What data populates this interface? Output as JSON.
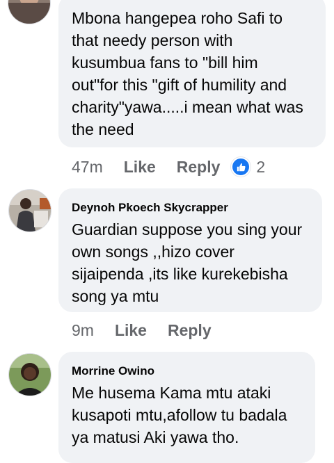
{
  "comments": [
    {
      "author": "",
      "lines": [
        "Mbona hangepea roho Safi to",
        "that needy person with",
        "kusumbua fans to \"bill him",
        "out\"for this \"gift of humility and",
        "charity\"yawa.....i mean what was",
        "the need"
      ],
      "time": "47m",
      "like_label": "Like",
      "reply_label": "Reply",
      "reaction_icon": "like-icon",
      "reaction_count": "2"
    },
    {
      "author": "Deynoh Pkoech Skycrapper",
      "lines": [
        "Guardian suppose you sing your",
        "own songs ,,hizo cover",
        "sijaipenda ,its like kurekebisha",
        "song ya mtu"
      ],
      "time": "9m",
      "like_label": "Like",
      "reply_label": "Reply"
    },
    {
      "author": "Morrine Owino",
      "lines": [
        "Me husema Kama mtu ataki",
        "kusapoti mtu,afollow tu badala",
        "ya matusi Aki yawa tho."
      ]
    }
  ],
  "colors": {
    "bubble": "#f0f2f5",
    "meta_text": "#65676b",
    "like_blue": "#1877f2"
  }
}
